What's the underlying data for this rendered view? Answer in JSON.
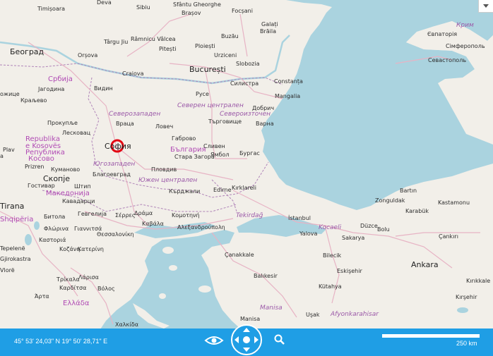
{
  "toolbar": {
    "coordinates": "45° 53' 24,03\" N 19° 50' 28,71\" E",
    "scale_label": "250 km"
  },
  "marker": {
    "label": "Sofia"
  },
  "labels": {
    "timisoara": "Timișoara",
    "deva": "Deva",
    "sibiu": "Sibiu",
    "sfantu": "Sfântu Gheorghe",
    "brasov": "Brașov",
    "focsani": "Focșani",
    "galati": "Galați",
    "braila": "Brăila",
    "beograd": "Београд",
    "ramnicu": "Râmnicu Vâlcea",
    "buzau": "Buzău",
    "targu_jiu": "Târgu Jiu",
    "pitesti": "Pitești",
    "ploiesti": "Ploiești",
    "urziceni": "Urziceni",
    "orsova": "Orșova",
    "bucuresti": "București",
    "craiova": "Craiova",
    "slobozia": "Slobozia",
    "constanta": "Constanța",
    "srbija": "Србија",
    "jagodina": "Јагодина",
    "vidin": "Видин",
    "silistra": "Силистра",
    "ruse": "Русе",
    "mangalia": "Mangalia",
    "kraljevo": "Краљево",
    "sever_central": "Северен централен",
    "dobrich": "Добрич",
    "severozapaden": "Северозападен",
    "severoiztochen": "Североизточен",
    "prokuplje": "Прокупље",
    "vratsa": "Враца",
    "targovishte": "Търговище",
    "lovech": "Ловеч",
    "varna": "Варна",
    "leskovac": "Лесковац",
    "gabrovo": "Габрово",
    "republika": "Republika",
    "kosoves": "e Kosovës",
    "republika2": "Република",
    "kosovo": "Косово",
    "bulgaria": "България",
    "sliven": "Сливен",
    "yambol": "Ямбол",
    "burgas": "Бургас",
    "sofia": "София",
    "stara_zagora": "Стара Загора",
    "prizren": "Prizren",
    "yugozapaden": "Югозападен",
    "kumanovo": "Куманово",
    "blagoevgrad": "Благоевград",
    "plovdiv": "Пловдив",
    "skopje": "Скопје",
    "yuzhen": "Южен централен",
    "shtip": "Штип",
    "gostivar": "Гостивар",
    "kardzhali": "Кърджали",
    "edirne": "Edirne",
    "kirklareli": "Kırklareli",
    "bartin": "Bartın",
    "makedonija": "Македонија",
    "kavadarci": "Кавадарци",
    "zonguldak": "Zonguldak",
    "kastamonu": "Kastamonu",
    "karabuk": "Karabük",
    "bitola": "Битола",
    "gevgelija": "Гевгелија",
    "serres": "Σέρρες",
    "drama": "Δράμα",
    "komotini": "Κομοτηνή",
    "tekirdag": "Tekirdağ",
    "florina": "Φλώρινα",
    "giannitsa": "Γιαννιτσά",
    "thessaloniki": "Θεσσαλονίκη",
    "kavala": "Καβάλα",
    "alexandroupoli": "Αλεξανδρούπολη",
    "istanbul": "İstanbul",
    "kocaeli": "Kocaeli",
    "duzce": "Düzce",
    "bolu": "Bolu",
    "kastoria": "Καστοριά",
    "yalova": "Yalova",
    "cankiri": "Çankırı",
    "kozani": "Κοζάνη",
    "katerini": "Κατερίνη",
    "canakkale": "Çanakkale",
    "bilecik": "Bilecik",
    "sakarya": "Sakarya",
    "tepelene": "Tepelenë",
    "gjirokaster": "Gjirokastra",
    "ankara": "Ankara",
    "eskisehir": "Eskişehir",
    "balikesir": "Balıkesir",
    "trikala": "Τρίκαλα",
    "larisa": "Λάρισα",
    "kutahya": "Kütahya",
    "karditsa": "Καρδίτσα",
    "volos": "Βόλος",
    "kirsehir": "Kırşehir",
    "arta": "Άρτα",
    "manisa_region": "Manisa",
    "usak": "Uşak",
    "ellada": "Ελλάδα",
    "afyon": "Afyonkarahisar",
    "manisa": "Manisa",
    "halkida": "Χαλκίδα",
    "krym": "Крим",
    "evpatoriya": "Євпаторія",
    "simferopol": "Сімферополь",
    "sevastopol": "Севастополь",
    "shqiperia": "Shqipëria",
    "vlore": "Vlorë",
    "tirana": "Tirana",
    "lezhe": "ezhe",
    "plav": "Plav",
    "kraljevo2": "ожице",
    "a_edge": "а",
    "kirikkale": "Kırıkkale",
    "nise": "Niš"
  }
}
